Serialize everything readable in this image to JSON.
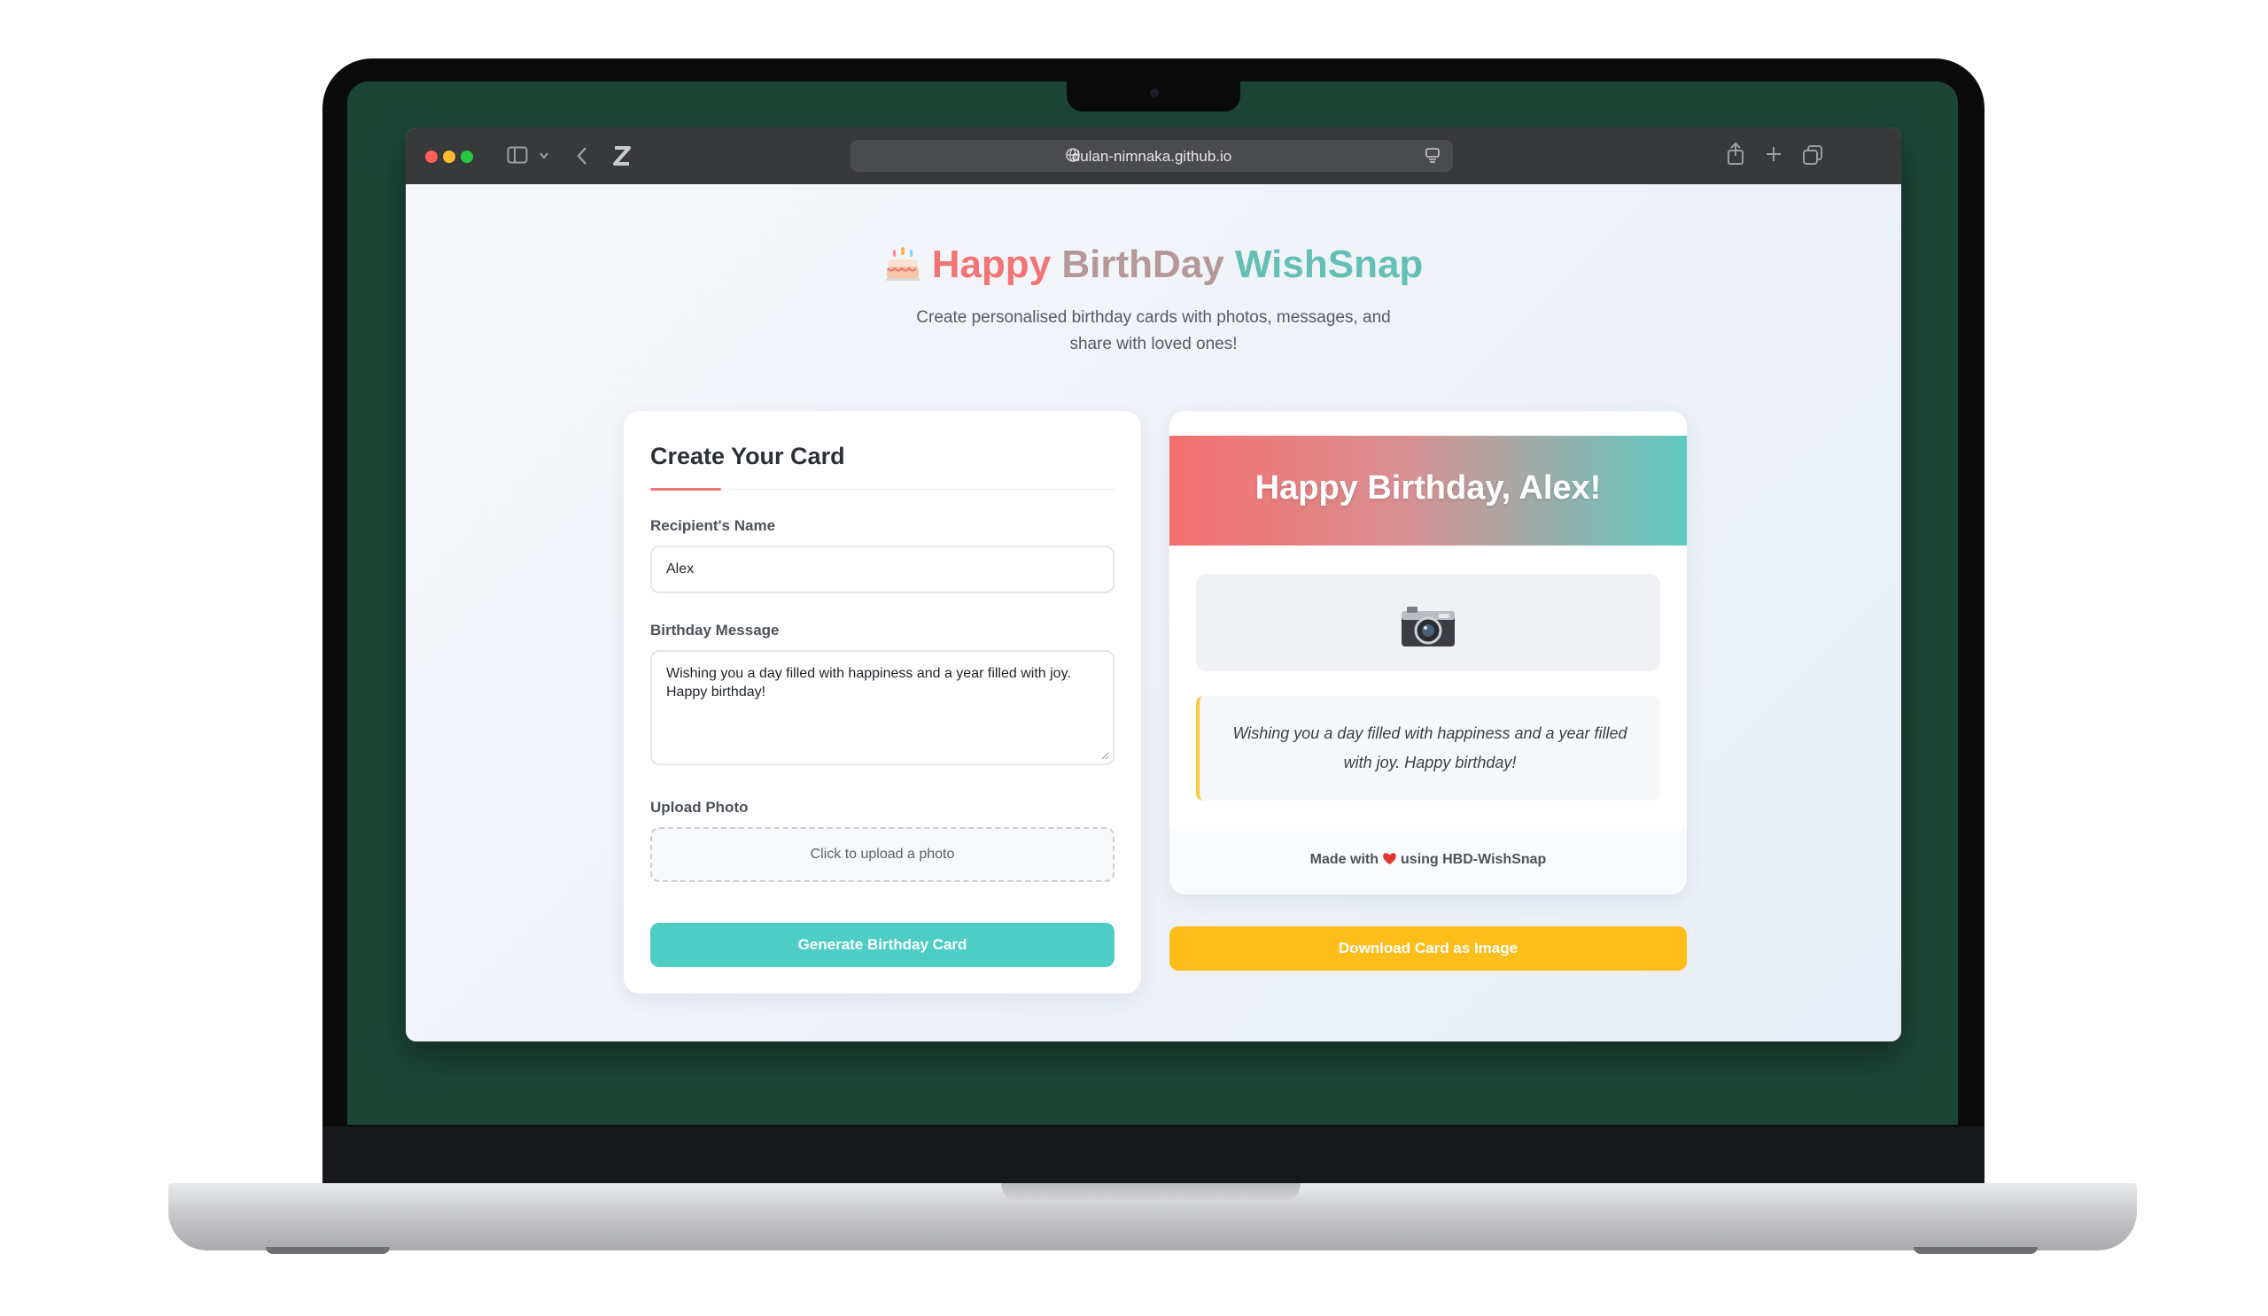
{
  "browser": {
    "url": "dulan-nimnaka.github.io",
    "traffic_lights": {
      "close": "#ff5f57",
      "minimize": "#febc2e",
      "zoom": "#28c840"
    }
  },
  "header": {
    "title_part1": "Happy",
    "title_part2": "BirthDay",
    "title_part3": "WishSnap",
    "subtitle": "Create personalised birthday cards with photos, messages, and share with loved ones!"
  },
  "form": {
    "title": "Create Your Card",
    "name_label": "Recipient's Name",
    "name_value": "Alex",
    "message_label": "Birthday Message",
    "message_value": "Wishing you a day filled with happiness and a year filled with joy. Happy birthday!",
    "photo_label": "Upload Photo",
    "photo_prompt": "Click to upload a photo",
    "generate_button": "Generate Birthday Card"
  },
  "preview": {
    "heading": "Happy Birthday, Alex!",
    "message": "Wishing you a day filled with happiness and a year filled with joy. Happy birthday!",
    "footer_prefix": "Made with",
    "footer_suffix": "using HBD-WishSnap",
    "download_button": "Download Card as Image"
  },
  "colors": {
    "accent_teal": "#4ecdc4",
    "accent_coral": "#f27474",
    "accent_yellow": "#ffbd1b",
    "laptop_wallpaper": "#1d4536"
  }
}
